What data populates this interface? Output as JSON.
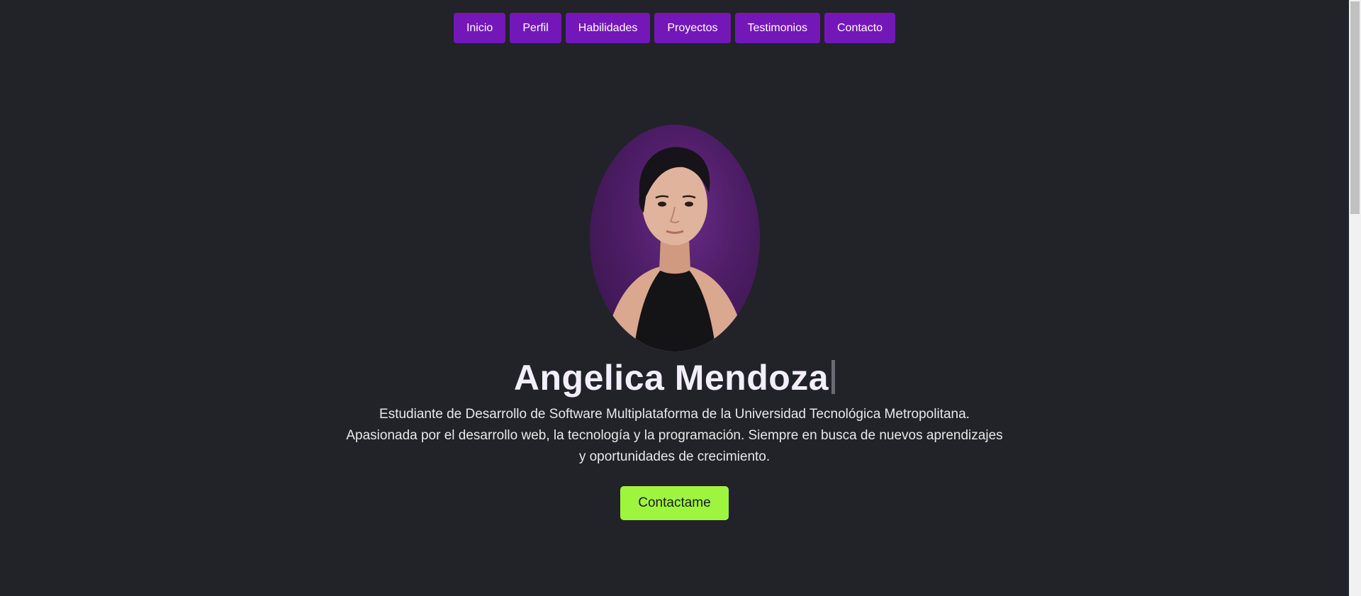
{
  "nav": {
    "items": [
      {
        "label": "Inicio"
      },
      {
        "label": "Perfil"
      },
      {
        "label": "Habilidades"
      },
      {
        "label": "Proyectos"
      },
      {
        "label": "Testimonios"
      },
      {
        "label": "Contacto"
      }
    ]
  },
  "hero": {
    "name": "Angelica Mendoza",
    "description_lines": [
      "Estudiante de Desarrollo de Software Multiplataforma de la Universidad Tecnológica Metropolitana.",
      "Apasionada por el desarrollo web, la tecnología y la programación. Siempre en busca de nuevos aprendizajes",
      "y oportunidades de crecimiento."
    ],
    "cta_label": "Contactame"
  },
  "colors": {
    "background": "#212328",
    "nav_button": "#7417b8",
    "cta_button": "#9ef53f",
    "heading_text": "#f3eefc"
  }
}
